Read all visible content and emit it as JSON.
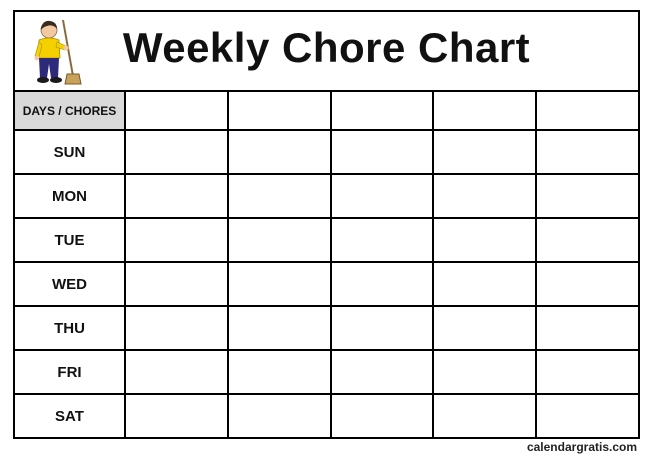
{
  "header": {
    "title": "Weekly Chore Chart",
    "icon": "person-with-broom-icon"
  },
  "table": {
    "corner_label": "DAYS / CHORES",
    "chore_columns": 5,
    "days": [
      "SUN",
      "MON",
      "TUE",
      "WED",
      "THU",
      "FRI",
      "SAT"
    ]
  },
  "footer": {
    "credit": "calendargratis.com"
  },
  "colors": {
    "border": "#000000",
    "corner_fill": "#d9d9d9",
    "shirt": "#f5d000",
    "trousers": "#2e2a7a"
  }
}
